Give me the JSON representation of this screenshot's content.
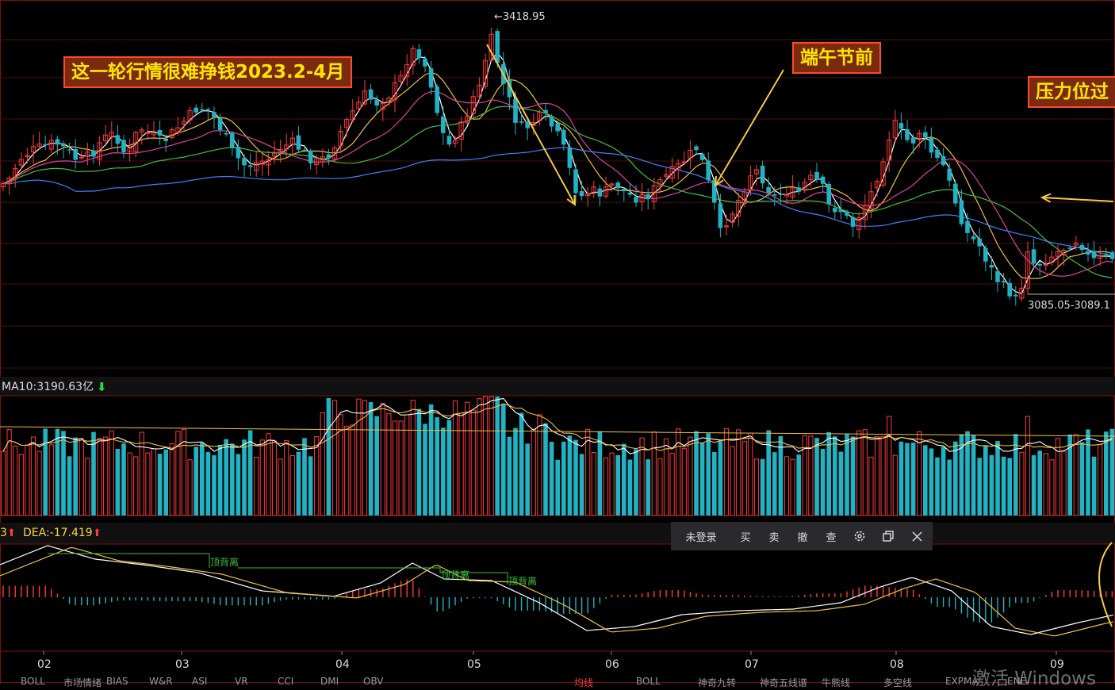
{
  "chart_data": [
    {
      "type": "candlestick",
      "panel": "price",
      "title": "",
      "x_month_ticks": [
        "02",
        "03",
        "04",
        "05",
        "06",
        "07",
        "08",
        "09"
      ],
      "high_label": "←3418.95",
      "high_value": 3418.95,
      "low_label": "3085.05-3089.1",
      "low_range": [
        3085.05,
        3089.1
      ],
      "series": [
        {
          "name": "",
          "color": "#ffffff"
        },
        {
          "name": "",
          "color": "#f0c040"
        },
        {
          "name": "",
          "color": "#e040a0"
        },
        {
          "name": "",
          "color": "#40c040"
        },
        {
          "name": "",
          "color": "#4080ff"
        }
      ],
      "grid": true
    },
    {
      "type": "bar",
      "panel": "volume",
      "label_text": "MA10:3190.63亿",
      "ma10": "3190.63亿",
      "arrow": "down",
      "grid": false
    },
    {
      "type": "bar",
      "panel": "macd",
      "label_fragment": "3",
      "dea_label": "DEA:-17.419",
      "dea": -17.419,
      "arrow": "up",
      "divergence_labels": [
        "顶背离",
        "顶背离",
        "顶背离"
      ]
    }
  ],
  "annotations": {
    "box1": "这一轮行情很难挣钱2023.2-4月",
    "box2": "端午节前",
    "box3": "压力位过"
  },
  "toolbar": {
    "login": "未登录",
    "buy": "买",
    "sell": "卖",
    "cancel": "撤",
    "query": "查",
    "settings_icon": "gear-icon",
    "restore_icon": "restore-icon",
    "close_icon": "close-icon"
  },
  "bottom_tabs_left": [
    "BOLL",
    "市场情绪",
    "BIAS",
    "W&R",
    "ASI",
    "VR",
    "CCI",
    "DMI",
    "OBV"
  ],
  "bottom_tabs_right": [
    "均线",
    "BOLL",
    "神奇九转",
    "神奇五线谱",
    "牛熊线",
    "多空线",
    "EXPMA",
    "ENE"
  ],
  "watermark": "激活 Windows",
  "colors": {
    "up": "#ff3b3b",
    "down": "#21b2c3",
    "annotation_bg": "#7a2b0f",
    "annotation_text": "#ffe600",
    "annotation_border": "#ff4a2a",
    "arrow": "#f5c842",
    "divergence": "#39c039"
  }
}
